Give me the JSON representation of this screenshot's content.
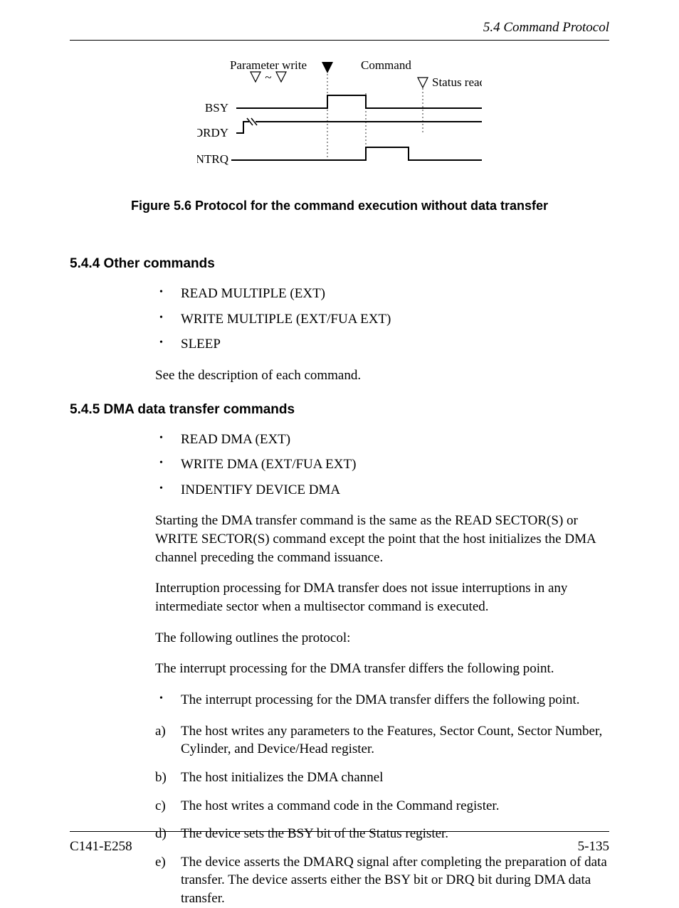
{
  "header": {
    "section_label": "5.4  Command Protocol"
  },
  "figure": {
    "labels": {
      "param_write": "Parameter write",
      "command": "Command",
      "status_read": "Status read",
      "bsy": "BSY",
      "drdy": "DRDY",
      "intrq": "INTRQ"
    },
    "caption": "Figure 5.6  Protocol for the command execution without data transfer"
  },
  "sections": {
    "other": {
      "heading": "5.4.4  Other commands",
      "bullets": [
        "READ MULTIPLE (EXT)",
        "WRITE MULTIPLE (EXT/FUA EXT)",
        "SLEEP"
      ],
      "note": "See the description of each command."
    },
    "dma": {
      "heading": "5.4.5  DMA data transfer commands",
      "bullets": [
        "READ DMA (EXT)",
        "WRITE DMA (EXT/FUA EXT)",
        "INDENTIFY DEVICE DMA"
      ],
      "p1": "Starting the DMA transfer command is the same as the READ SECTOR(S) or WRITE SECTOR(S) command except the point that the host initializes the DMA channel preceding the command issuance.",
      "p2": "Interruption processing for DMA transfer does not issue interruptions in any intermediate sector when a multisector command is executed.",
      "p3": "The following outlines the protocol:",
      "p4": "The interrupt processing for the DMA transfer differs the following point.",
      "bullet_repeat": "The interrupt processing for the DMA transfer differs the following point.",
      "steps": [
        {
          "marker": "a)",
          "text": "The host writes any parameters to the Features, Sector Count, Sector Number, Cylinder, and Device/Head register."
        },
        {
          "marker": "b)",
          "text": "The host initializes the DMA channel"
        },
        {
          "marker": "c)",
          "text": "The host writes a command code in the Command register."
        },
        {
          "marker": "d)",
          "text": "The device sets the BSY bit of the Status register."
        },
        {
          "marker": "e)",
          "text": "The device asserts the DMARQ signal after completing the preparation of data transfer.  The device asserts either the BSY bit or DRQ bit during DMA data transfer."
        }
      ]
    }
  },
  "footer": {
    "left": "C141-E258",
    "right": "5-135"
  }
}
